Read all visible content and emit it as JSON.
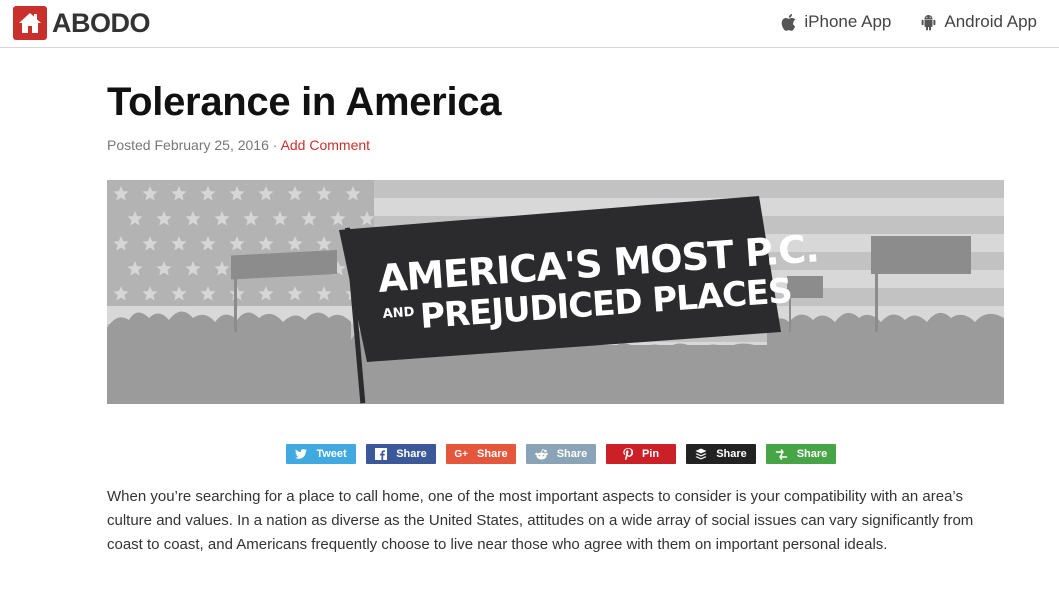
{
  "header": {
    "brand": "ABODO",
    "iphone_label": "iPhone App",
    "android_label": "Android App"
  },
  "article": {
    "title": "Tolerance in America",
    "posted": "Posted February 25, 2016 · ",
    "add_comment": "Add Comment",
    "banner_line1": "AMERICA'S MOST P.C.",
    "banner_and": "AND",
    "banner_line2": "PREJUDICED PLACES",
    "paragraph": "When you’re searching for a place to call home, one of the most important aspects to consider is your compatibility with an area’s culture and values. In a nation as diverse as the United States, attitudes on a wide array of social issues can vary significantly from coast to coast, and Americans frequently choose to live near those who agree with them on important personal ideals."
  },
  "share": {
    "tweet": "Tweet",
    "facebook": "Share",
    "googleplus": "Share",
    "reddit": "Share",
    "pinterest": "Pin",
    "buffer": "Share",
    "mewe": "Share",
    "googleplus_icon_text": "G+"
  },
  "colors": {
    "brand_red": "#c9302c",
    "banner_dark": "#2b2b2d"
  }
}
